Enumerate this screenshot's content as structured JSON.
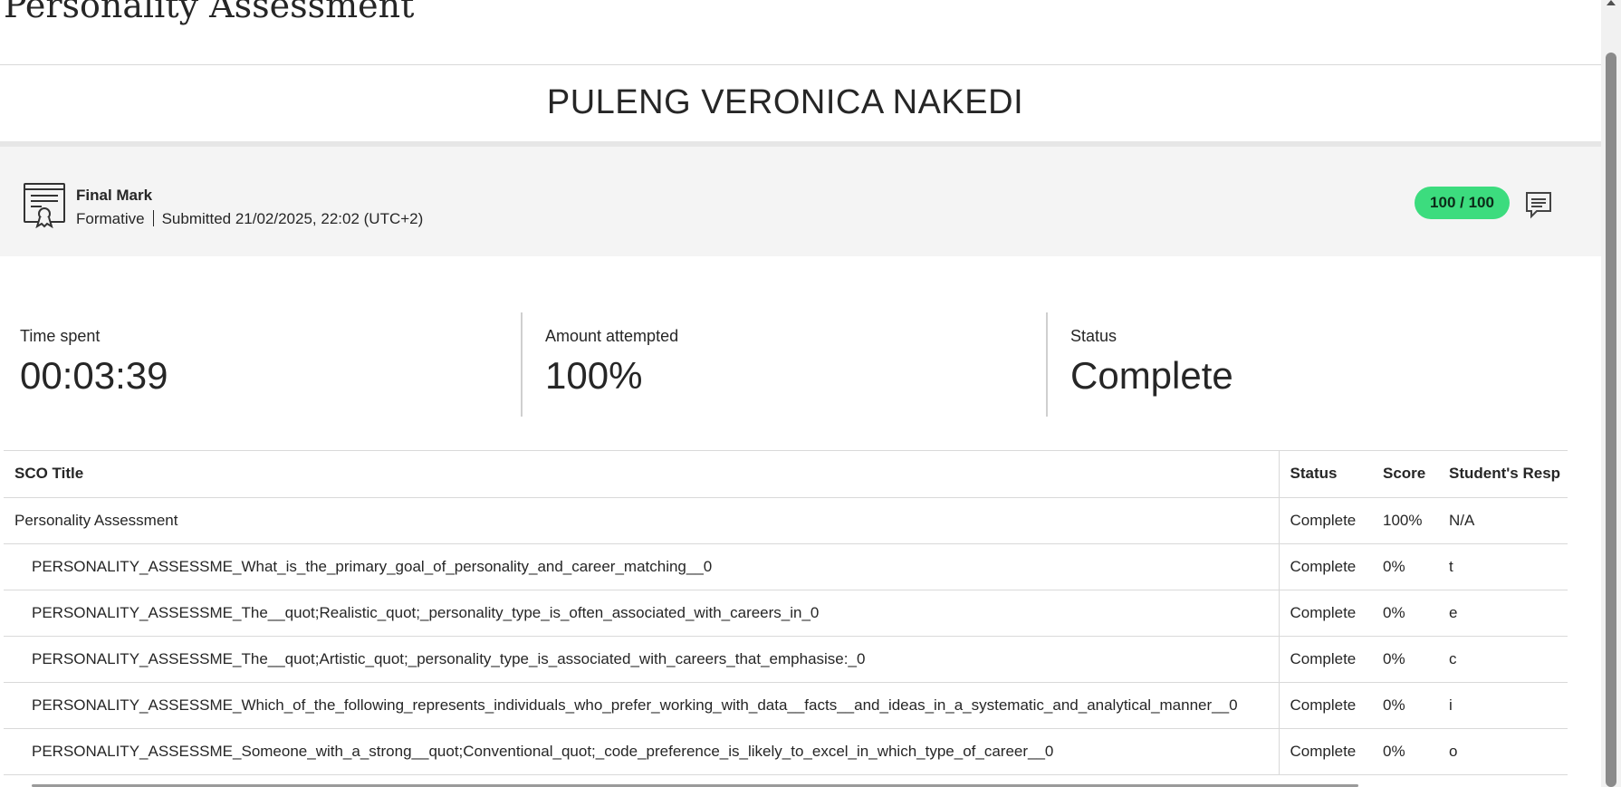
{
  "page": {
    "title": "Personality Assessment",
    "student_name": "PULENG VERONICA NAKEDI"
  },
  "final_mark": {
    "title": "Final Mark",
    "type": "Formative",
    "submitted": "Submitted 21/02/2025, 22:02 (UTC+2)",
    "score": "100 / 100",
    "score_color": "#3cdc7e",
    "icon": "certificate-icon",
    "comment_icon": "comment-icon"
  },
  "stats": [
    {
      "label": "Time spent",
      "value": "00:03:39"
    },
    {
      "label": "Amount attempted",
      "value": "100%"
    },
    {
      "label": "Status",
      "value": "Complete"
    }
  ],
  "table": {
    "headers": [
      "SCO Title",
      "Status",
      "Score",
      "Student's Resp"
    ],
    "rows": [
      {
        "title": "Personality Assessment",
        "status": "Complete",
        "score": "100%",
        "response": "N/A"
      },
      {
        "title": "PERSONALITY_ASSESSME_What_is_the_primary_goal_of_personality_and_career_matching__0",
        "status": "Complete",
        "score": "0%",
        "response": "t"
      },
      {
        "title": "PERSONALITY_ASSESSME_The__quot;Realistic_quot;_personality_type_is_often_associated_with_careers_in_0",
        "status": "Complete",
        "score": "0%",
        "response": "e"
      },
      {
        "title": "PERSONALITY_ASSESSME_The__quot;Artistic_quot;_personality_type_is_associated_with_careers_that_emphasise:_0",
        "status": "Complete",
        "score": "0%",
        "response": "c"
      },
      {
        "title": "PERSONALITY_ASSESSME_Which_of_the_following_represents_individuals_who_prefer_working_with_data__facts__and_ideas_in_a_systematic_and_analytical_manner__0",
        "status": "Complete",
        "score": "0%",
        "response": "i"
      },
      {
        "title": "PERSONALITY_ASSESSME_Someone_with_a_strong__quot;Conventional_quot;_code_preference_is_likely_to_excel_in_which_type_of_career__0",
        "status": "Complete",
        "score": "0%",
        "response": "o"
      }
    ]
  }
}
